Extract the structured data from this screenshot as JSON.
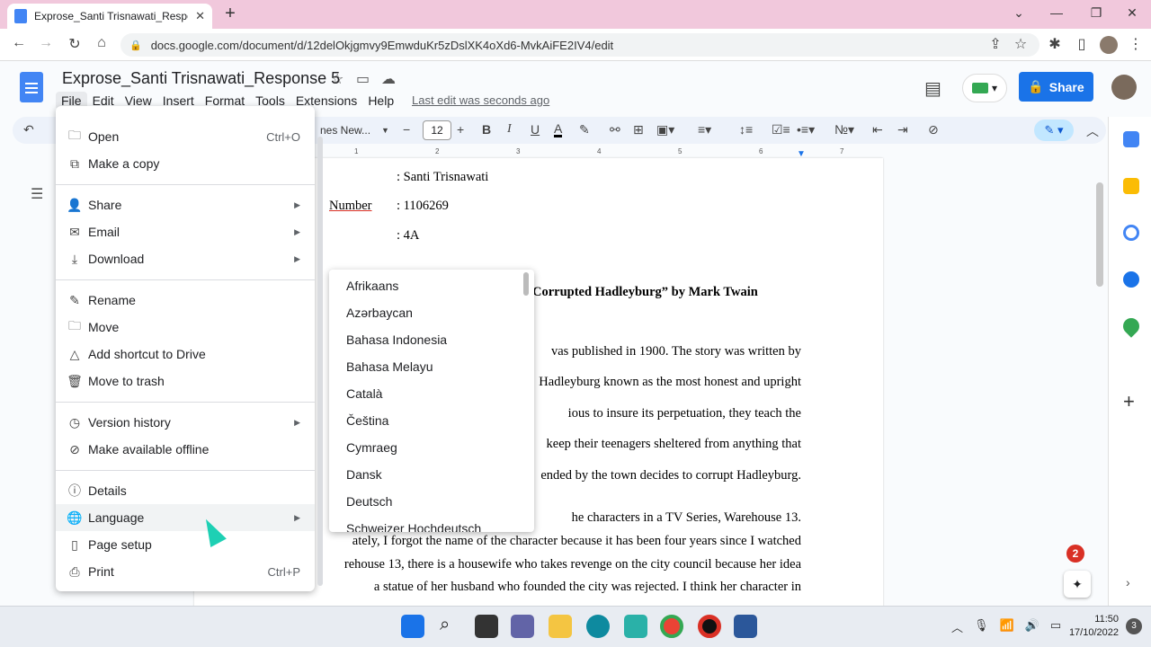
{
  "browser": {
    "tab_title": "Exprose_Santi Trisnawati_Respon",
    "url": "docs.google.com/document/d/12delOkjgmvy9EmwduKr5zDslXK4oXd6-MvkAiFE2IV4/edit"
  },
  "docs": {
    "title": "Exprose_Santi Trisnawati_Response 5",
    "menu": [
      "File",
      "Edit",
      "View",
      "Insert",
      "Format",
      "Tools",
      "Extensions",
      "Help"
    ],
    "last_edit": "Last edit was seconds ago",
    "share_label": "Share",
    "font_name": "nes New...",
    "font_size": "12"
  },
  "file_menu": {
    "items": [
      {
        "label": "Open",
        "shortcut": "Ctrl+O",
        "icon": "folder-icon"
      },
      {
        "label": "Make a copy",
        "icon": "copy-icon"
      },
      {
        "label": "Share",
        "icon": "person-add-icon",
        "submenu": true
      },
      {
        "label": "Email",
        "icon": "mail-icon",
        "submenu": true
      },
      {
        "label": "Download",
        "icon": "download-icon",
        "submenu": true
      },
      {
        "label": "Rename",
        "icon": "rename-icon"
      },
      {
        "label": "Move",
        "icon": "move-folder-icon"
      },
      {
        "label": "Add shortcut to Drive",
        "icon": "drive-shortcut-icon"
      },
      {
        "label": "Move to trash",
        "icon": "trash-icon"
      },
      {
        "label": "Version history",
        "icon": "history-icon",
        "submenu": true
      },
      {
        "label": "Make available offline",
        "icon": "offline-icon"
      },
      {
        "label": "Details",
        "icon": "info-icon"
      },
      {
        "label": "Language",
        "icon": "globe-icon",
        "submenu": true
      },
      {
        "label": "Page setup",
        "icon": "page-setup-icon"
      },
      {
        "label": "Print",
        "shortcut": "Ctrl+P",
        "icon": "print-icon"
      }
    ]
  },
  "language_menu": {
    "items": [
      "Afrikaans",
      "Azərbaycan",
      "Bahasa Indonesia",
      "Bahasa Melayu",
      "Català",
      "Čeština",
      "Cymraeg",
      "Dansk",
      "Deutsch",
      "Schweizer Hochdeutsch"
    ]
  },
  "document": {
    "line_name": ": Santi Trisnawati",
    "label_number": "Number",
    "line_number": ": 1106269",
    "line_class": ": 4A",
    "heading_fragment": "Corrupted Hadleyburg” by Mark Twain",
    "para1": [
      "vas published in 1900. The story was written by",
      "Hadleyburg known as the most honest and upright",
      "ious to insure its perpetuation, they teach the",
      "keep their teenagers sheltered from anything that",
      "ended by the town decides to corrupt Hadleyburg."
    ],
    "para2": [
      "he characters in a TV Series, Warehouse 13.",
      "ately, I forgot the name of the character because it has been four years since I watched",
      "rehouse 13, there is a housewife who takes revenge on the city council because her idea",
      "a statue of her husband who founded the city was rejected. I think her character in"
    ]
  },
  "notifications": {
    "badge": "2"
  },
  "taskbar": {
    "time": "11:50",
    "date": "17/10/2022",
    "notif_count": "3"
  },
  "colors": {
    "accent": "#1a73e8",
    "tab_strip": "#f1c8dc"
  }
}
